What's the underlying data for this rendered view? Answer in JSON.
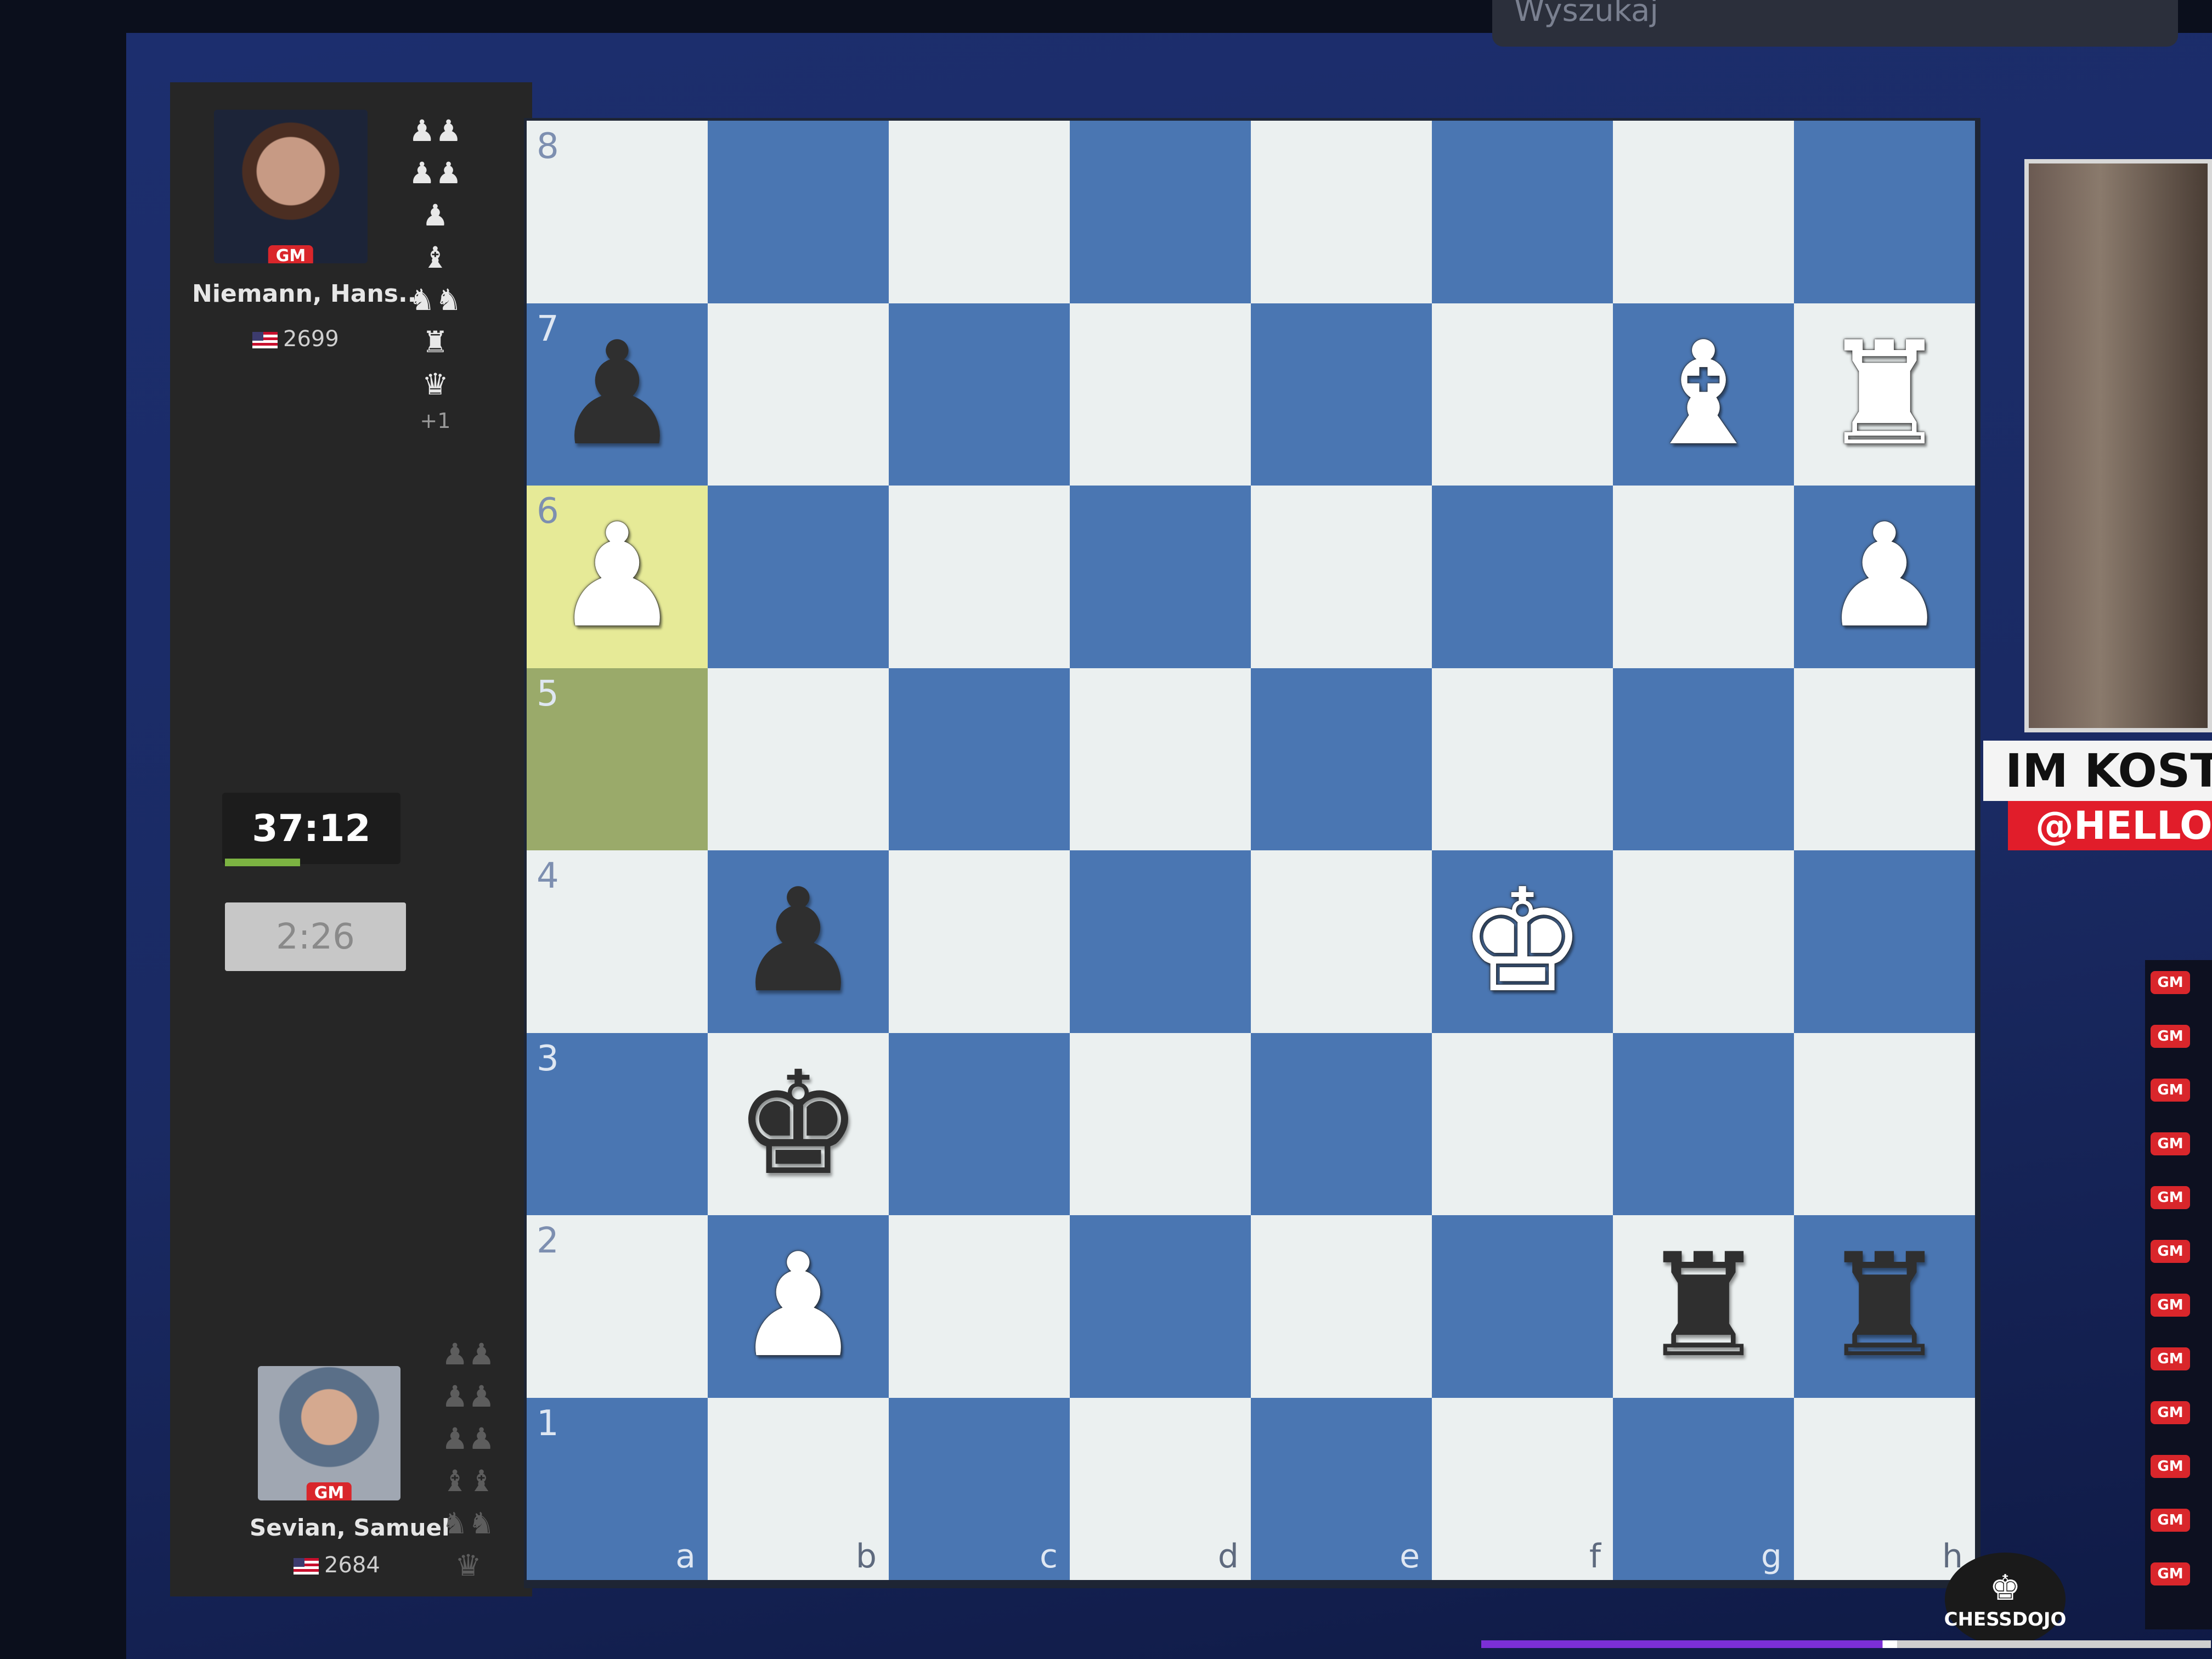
{
  "header": {
    "search_placeholder": "Wyszukaj"
  },
  "players": {
    "top": {
      "name": "Niemann, Hans...",
      "title": "GM",
      "rating": "2699",
      "captured": [
        "♟♟",
        "♟♟",
        "♟",
        "♝",
        "♞♞",
        "♜",
        "♛"
      ],
      "captured_extra": "+1"
    },
    "bottom": {
      "name": "Sevian, Samuel",
      "title": "GM",
      "rating": "2684",
      "captured": [
        "♟♟",
        "♟♟",
        "♟♟",
        "♝♝",
        "♞♞",
        "♛"
      ]
    }
  },
  "clocks": {
    "active": "37:12",
    "other": "2:26",
    "active_progress": 0.42
  },
  "board": {
    "files": [
      "a",
      "b",
      "c",
      "d",
      "e",
      "f",
      "g",
      "h"
    ],
    "ranks": [
      "8",
      "7",
      "6",
      "5",
      "4",
      "3",
      "2",
      "1"
    ],
    "highlighted_squares": [
      "a6",
      "a5"
    ],
    "pieces": [
      {
        "square": "a7",
        "color": "black",
        "type": "pawn",
        "glyph": "♟"
      },
      {
        "square": "g7",
        "color": "white",
        "type": "bishop",
        "glyph": "♝"
      },
      {
        "square": "h7",
        "color": "white",
        "type": "rook",
        "glyph": "♜"
      },
      {
        "square": "a6",
        "color": "white",
        "type": "pawn",
        "glyph": "♟"
      },
      {
        "square": "h6",
        "color": "white",
        "type": "pawn",
        "glyph": "♟"
      },
      {
        "square": "b4",
        "color": "black",
        "type": "pawn",
        "glyph": "♟"
      },
      {
        "square": "f4",
        "color": "white",
        "type": "king",
        "glyph": "♚"
      },
      {
        "square": "b3",
        "color": "black",
        "type": "king",
        "glyph": "♚"
      },
      {
        "square": "b2",
        "color": "white",
        "type": "pawn",
        "glyph": "♟"
      },
      {
        "square": "g2",
        "color": "black",
        "type": "rook",
        "glyph": "♜"
      },
      {
        "square": "h2",
        "color": "black",
        "type": "rook",
        "glyph": "♜"
      }
    ]
  },
  "stream": {
    "caster_name": "IM KOSTYA I",
    "caster_handle": "@HELLO",
    "chat_badges": [
      "GM",
      "GM",
      "GM",
      "GM",
      "GM",
      "GM",
      "GM",
      "GM",
      "GM",
      "GM",
      "GM",
      "GM"
    ],
    "logo_text": "CHESSDOJO"
  },
  "colors": {
    "light_square": "#ebf0f0",
    "dark_square": "#4a76b2",
    "highlight": "#e6ea97"
  }
}
